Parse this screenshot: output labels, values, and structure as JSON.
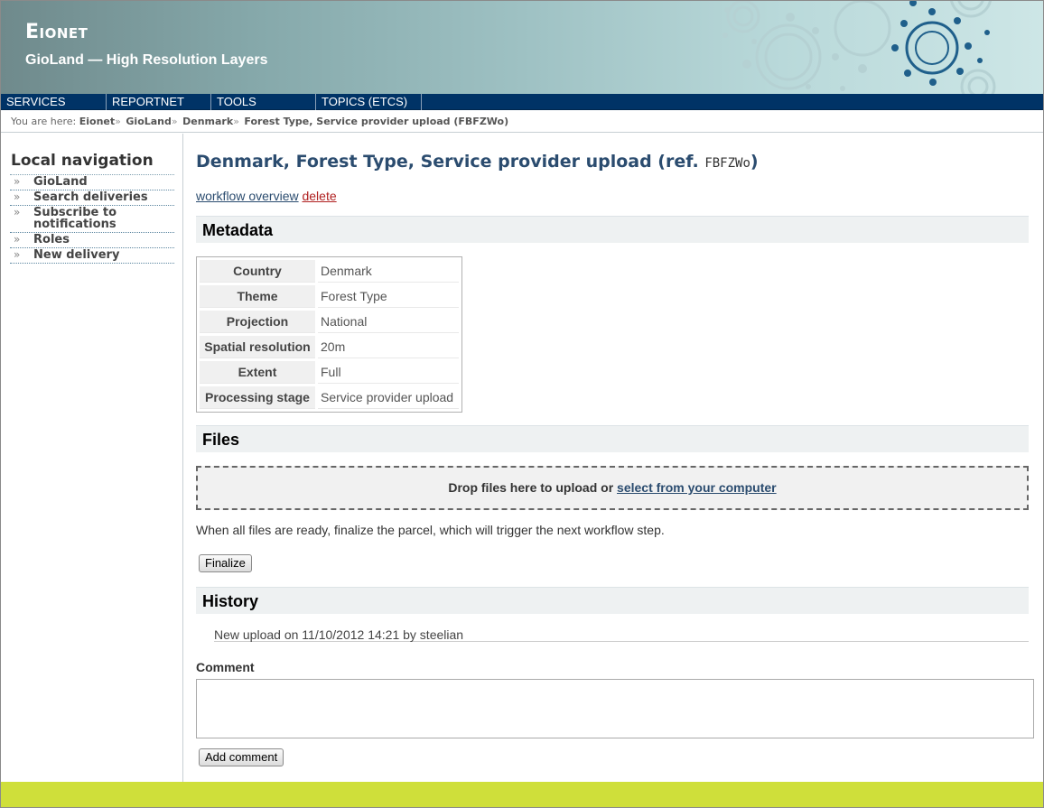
{
  "header": {
    "site_title": "Eionet",
    "subtitle": "GioLand — High Resolution Layers"
  },
  "topnav": {
    "items": [
      {
        "label": "SERVICES"
      },
      {
        "label": "REPORTNET"
      },
      {
        "label": "TOOLS"
      },
      {
        "label": "TOPICS (ETCS)"
      }
    ]
  },
  "breadcrumb": {
    "prefix": "You are here:",
    "items": [
      {
        "label": "Eionet"
      },
      {
        "label": "GioLand"
      },
      {
        "label": "Denmark"
      },
      {
        "label": "Forest Type, Service provider upload (FBFZWo)"
      }
    ],
    "separator": "»"
  },
  "local_navigation": {
    "title": "Local navigation",
    "items": [
      {
        "label": "GioLand"
      },
      {
        "label": "Search deliveries"
      },
      {
        "label": "Subscribe to notifications"
      },
      {
        "label": "Roles"
      },
      {
        "label": "New delivery"
      }
    ]
  },
  "page": {
    "title": "Denmark, Forest Type, Service provider upload (ref.",
    "ref_code": "FBFZWo",
    "title_end": ")",
    "actions": {
      "workflow_overview": "workflow overview",
      "delete": "delete"
    }
  },
  "metadata": {
    "heading": "Metadata",
    "rows": [
      {
        "key": "Country",
        "value": "Denmark"
      },
      {
        "key": "Theme",
        "value": "Forest Type"
      },
      {
        "key": "Projection",
        "value": "National"
      },
      {
        "key": "Spatial resolution",
        "value": "20m"
      },
      {
        "key": "Extent",
        "value": "Full"
      },
      {
        "key": "Processing stage",
        "value": "Service provider upload"
      }
    ]
  },
  "files": {
    "heading": "Files",
    "drop_text": "Drop files here to upload or",
    "select_link": "select from your computer",
    "info": "When all files are ready, finalize the parcel, which will trigger the next workflow step.",
    "finalize_label": "Finalize"
  },
  "history": {
    "heading": "History",
    "entries": [
      {
        "text": "New upload on 11/10/2012 14:21 by steelian"
      }
    ]
  },
  "comment": {
    "label": "Comment",
    "value": "",
    "submit_label": "Add comment"
  },
  "colors": {
    "nav_bar": "#003366",
    "title_blue": "#2b4c6f",
    "delete_red": "#b02020",
    "footer": "#cfdf3a"
  }
}
